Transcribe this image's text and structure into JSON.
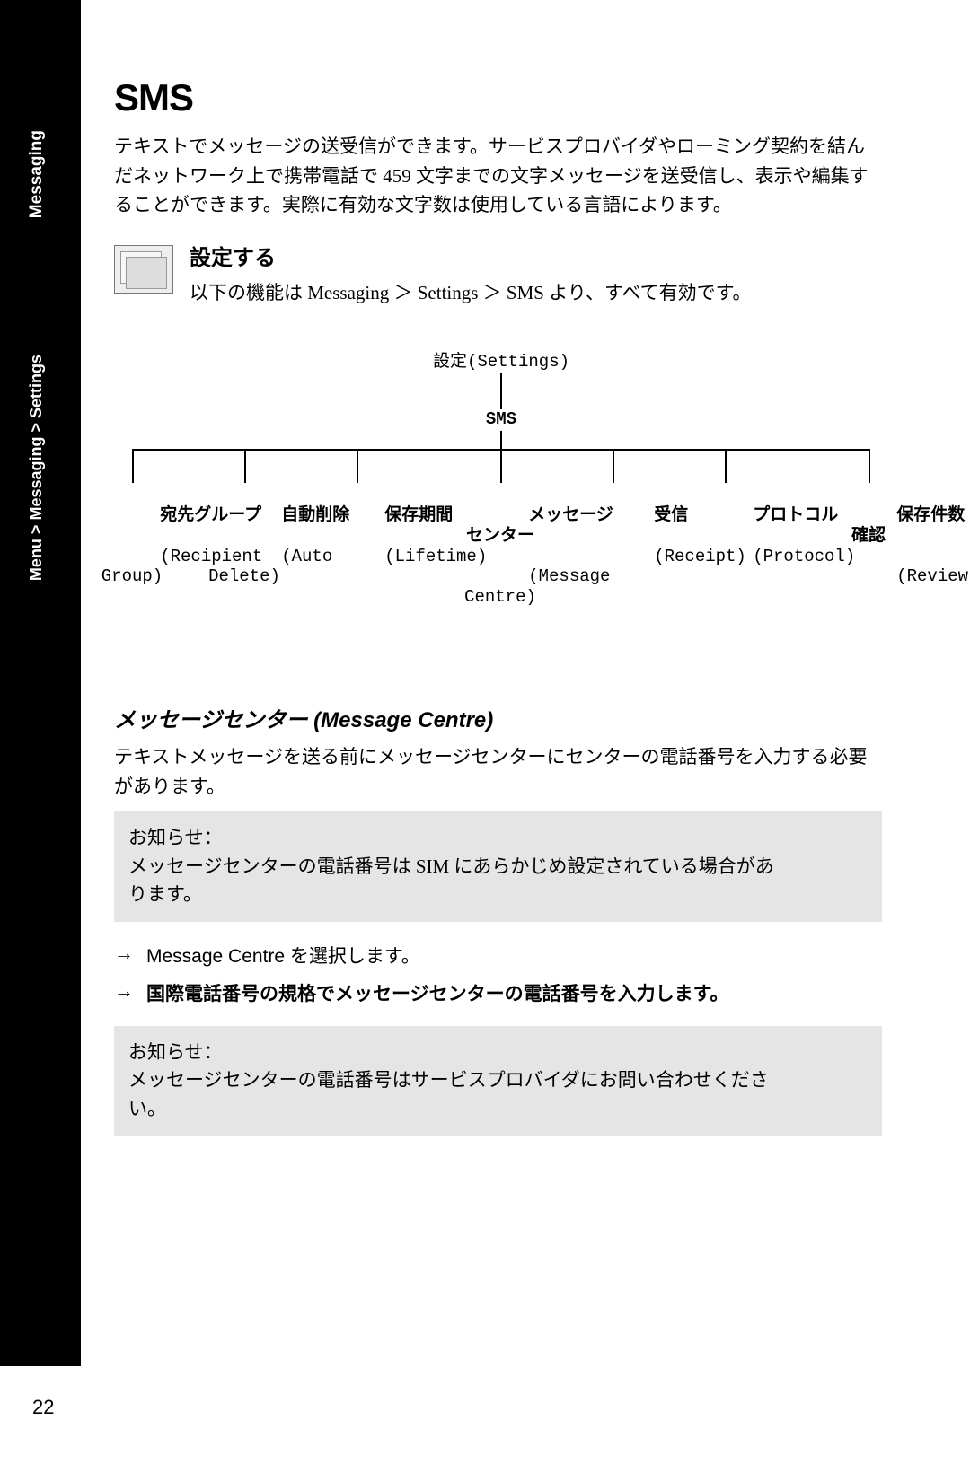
{
  "sidebar": {
    "section_label": "Messaging",
    "breadcrumb": "Menu > Messaging > Settings"
  },
  "heading": "SMS",
  "intro": "テキストでメッセージの送受信ができます。サービスプロバイダやローミング契約を結んだネットワーク上で携帯電話で 459 文字までの文字メッセージを送受信し、表示や編集することができます。実際に有効な文字数は使用している言語によります。",
  "settings": {
    "title": "設定する",
    "text": "以下の機能は Messaging ＞ Settings ＞ SMS より、すべて有効です。"
  },
  "tree": {
    "root": "設定(Settings)",
    "sms": "SMS",
    "leaves": [
      {
        "jp": "宛先グループ",
        "en": "(Recipient\nGroup)"
      },
      {
        "jp": "自動削除",
        "en": "(Auto\nDelete)"
      },
      {
        "jp": "保存期間",
        "en": "(Lifetime)"
      },
      {
        "jp": "メッセージ\nセンター",
        "en": "(Message\nCentre)"
      },
      {
        "jp": "受信",
        "en": "(Receipt)"
      },
      {
        "jp": "プロトコル",
        "en": "(Protocol)"
      },
      {
        "jp": "保存件数\n確認",
        "en": "(Review)"
      }
    ]
  },
  "sub": {
    "title": "メッセージセンター (Message Centre)",
    "para": "テキストメッセージを送る前にメッセージセンターにセンターの電話番号を入力する必要があります。",
    "note1_label": "お知らせ：",
    "note1_body": "メッセージセンターの電話番号は SIM にあらかじめ設定されている場合があります。",
    "step1": "Message Centre を選択します。",
    "step2": "国際電話番号の規格でメッセージセンターの電話番号を入力します。",
    "note2_label": "お知らせ：",
    "note2_body": "メッセージセンターの電話番号はサービスプロバイダにお問い合わせください。"
  },
  "page_number": "22",
  "arrow_glyph": "→"
}
